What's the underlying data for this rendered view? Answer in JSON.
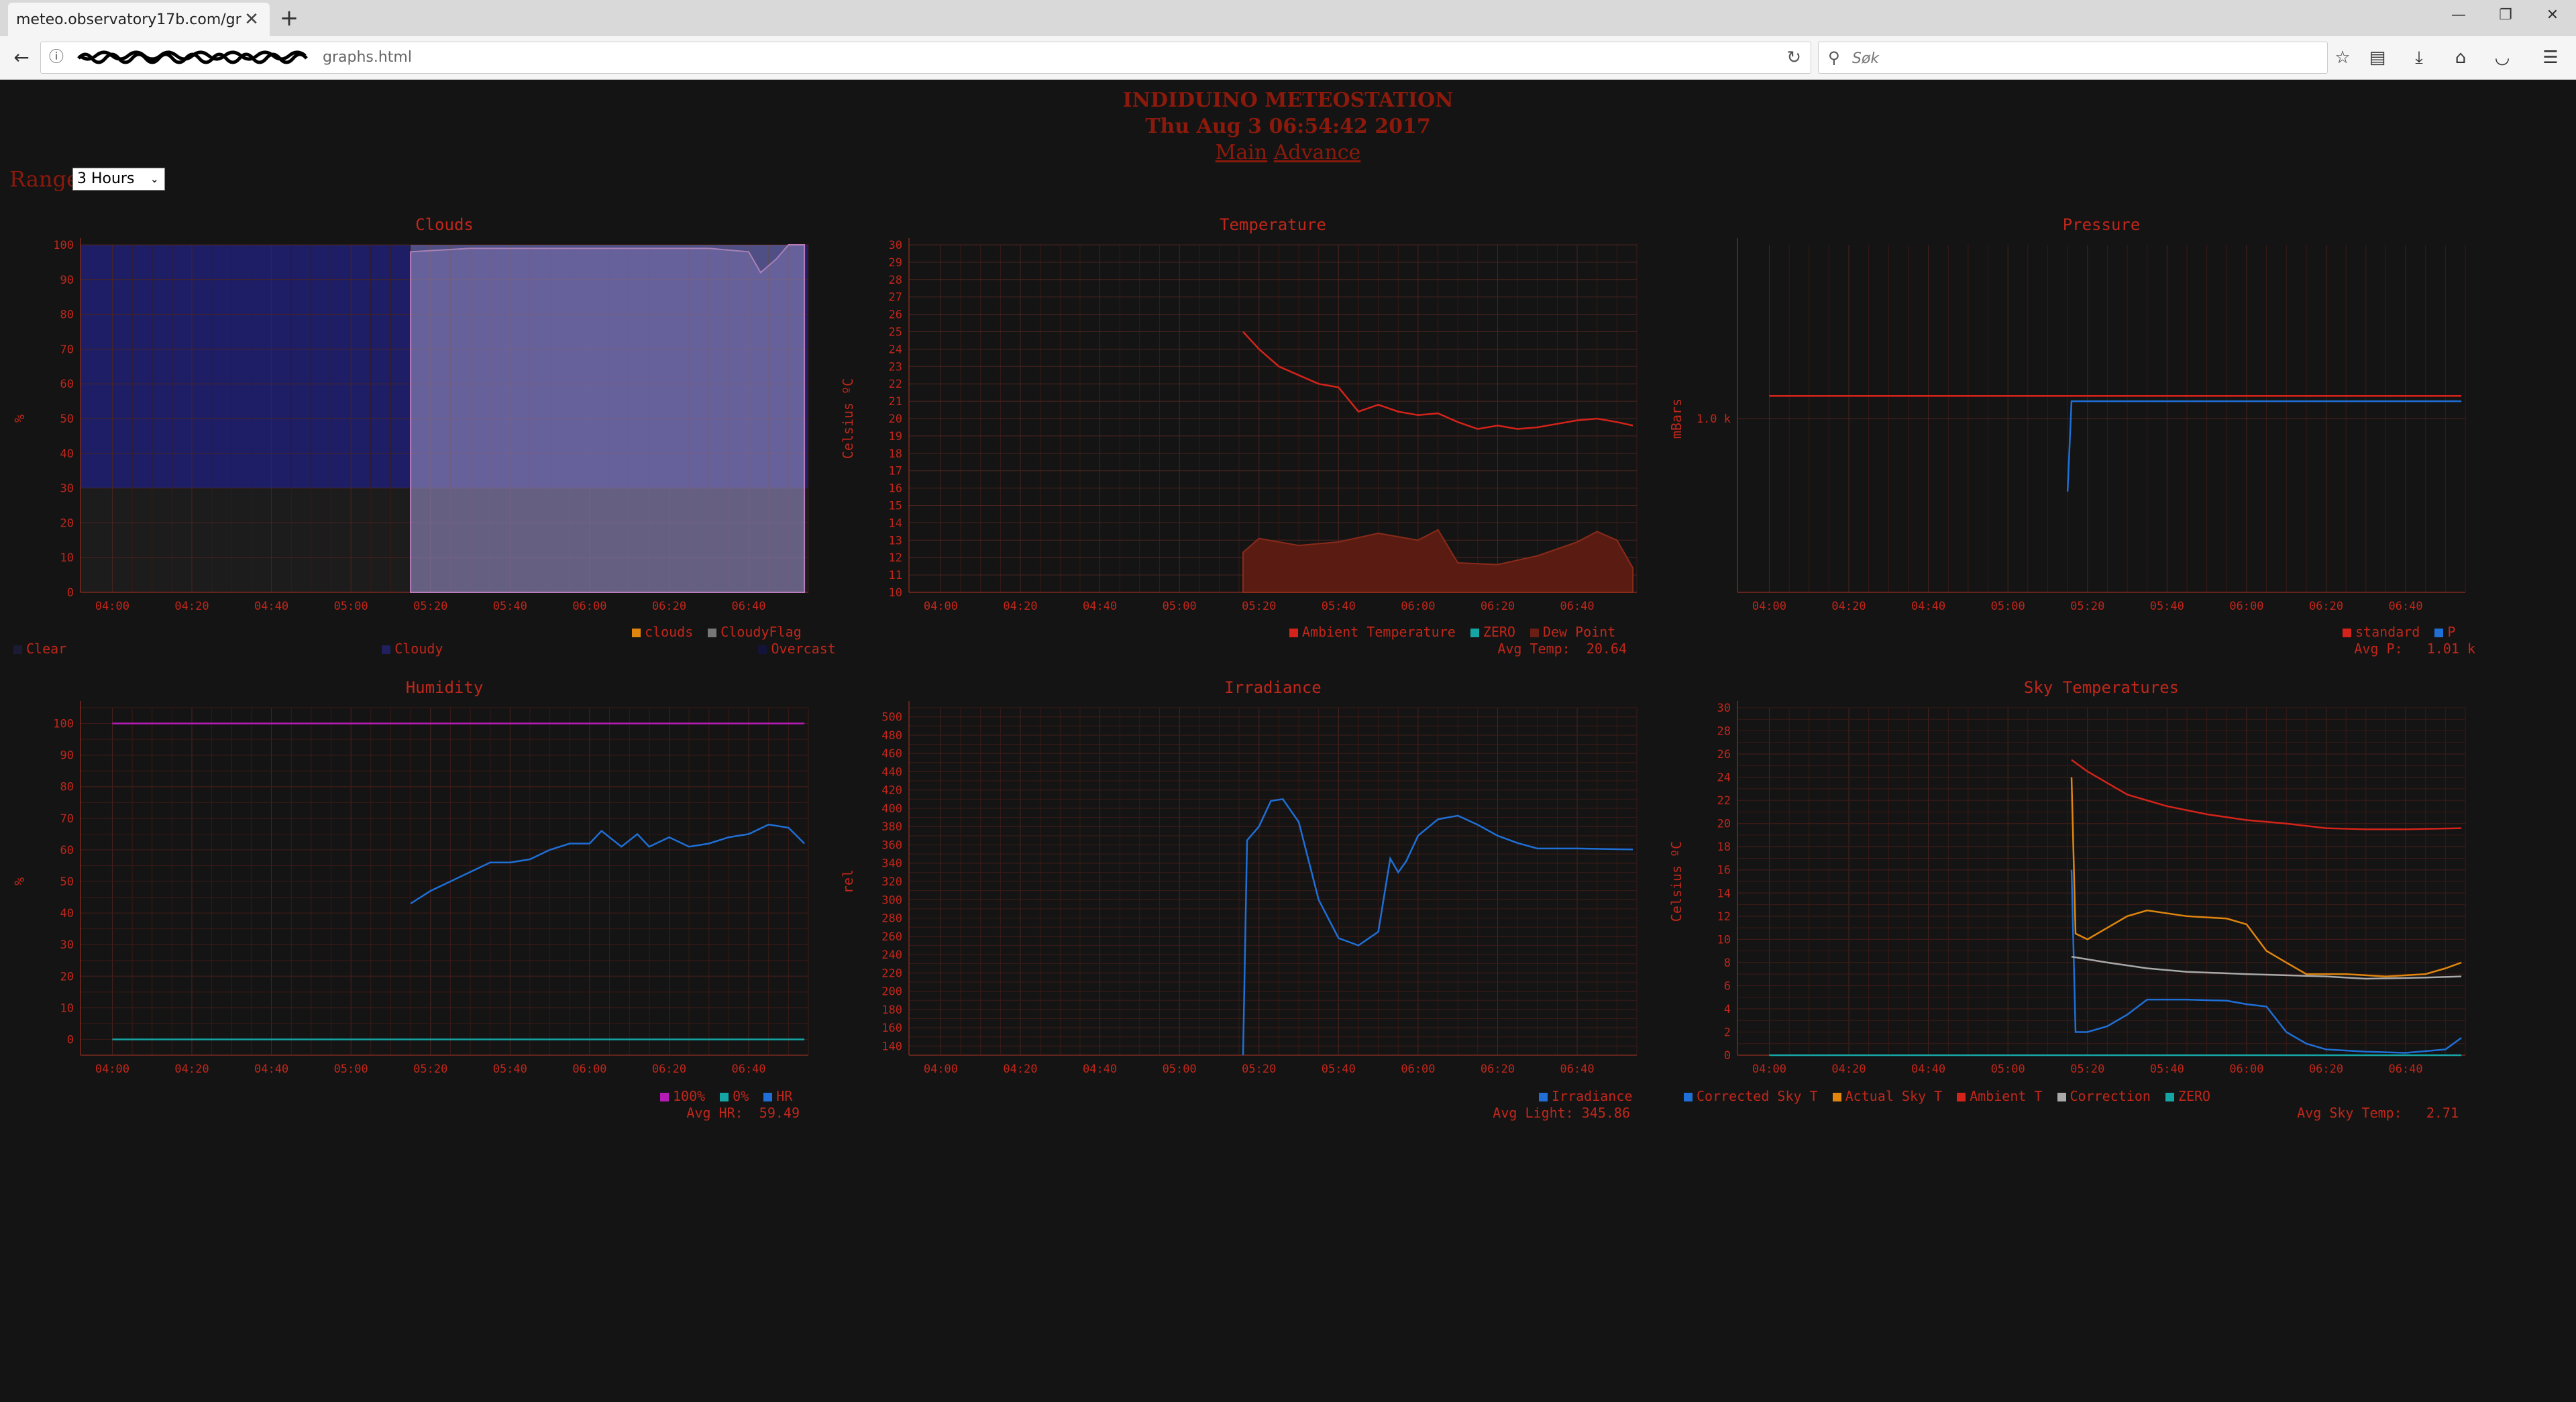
{
  "browser": {
    "tab_title": "meteo.observatory17b.com/grap",
    "url_suffix": "graphs.html",
    "search_placeholder": "Søk"
  },
  "page": {
    "title": "INDIDUINO METEOSTATION",
    "datetime": "Thu Aug 3 06:54:42 2017",
    "link_main": "Main",
    "link_advance": "Advance",
    "range_label": "Range",
    "range_value": "3 Hours"
  },
  "x_ticks": [
    "04:00",
    "04:20",
    "04:40",
    "05:00",
    "05:20",
    "05:40",
    "06:00",
    "06:20",
    "06:40"
  ],
  "charts": {
    "clouds": {
      "title": "Clouds",
      "ylabel": "%",
      "legend_row1": [
        {
          "label": "clouds",
          "color": "#e0860f"
        },
        {
          "label": "CloudyFlag",
          "color": "#777777"
        }
      ],
      "legend_row2": [
        {
          "label": "Clear",
          "color": "#1b1b36"
        },
        {
          "label": "Cloudy",
          "color": "#20205e"
        },
        {
          "label": "Overcast",
          "color": "#14143a"
        }
      ]
    },
    "temperature": {
      "title": "Temperature",
      "ylabel": "Celsius ºC",
      "legend": [
        {
          "label": "Ambient Temperature",
          "color": "#d4231a"
        },
        {
          "label": "ZERO",
          "color": "#16a5a5"
        },
        {
          "label": "Dew Point",
          "color": "#6b1e14"
        }
      ],
      "stat": "Avg Temp:  20.64"
    },
    "pressure": {
      "title": "Pressure",
      "ylabel": "mBars",
      "legend": [
        {
          "label": "standard",
          "color": "#d4231a"
        },
        {
          "label": "P",
          "color": "#1f6fd6"
        }
      ],
      "stat": "Avg P:   1.01 k"
    },
    "humidity": {
      "title": "Humidity",
      "ylabel": "%",
      "legend": [
        {
          "label": "100%",
          "color": "#b51bb5"
        },
        {
          "label": "0%",
          "color": "#16a5a5"
        },
        {
          "label": "HR",
          "color": "#1f6fd6"
        }
      ],
      "stat": "Avg HR:  59.49"
    },
    "irradiance": {
      "title": "Irradiance",
      "ylabel": "rel",
      "legend": [
        {
          "label": "Irradiance",
          "color": "#1f6fd6"
        }
      ],
      "stat": "Avg Light: 345.86"
    },
    "sky": {
      "title": "Sky Temperatures",
      "ylabel": "Celsius ºC",
      "legend": [
        {
          "label": "Corrected Sky T",
          "color": "#1f6fd6"
        },
        {
          "label": "Actual Sky T",
          "color": "#e0860f"
        },
        {
          "label": "Ambient T",
          "color": "#d4231a"
        },
        {
          "label": "Correction",
          "color": "#aaaaaa"
        },
        {
          "label": "ZERO",
          "color": "#16a5a5"
        }
      ],
      "stat": "Avg Sky Temp:   2.71"
    }
  },
  "chart_data": [
    {
      "type": "area",
      "title": "Clouds",
      "ylabel": "%",
      "x_ticks": [
        "04:00",
        "04:20",
        "04:40",
        "05:00",
        "05:20",
        "05:40",
        "06:00",
        "06:20",
        "06:40"
      ],
      "ylim": [
        0,
        100
      ],
      "ytick_values": [
        0,
        10,
        20,
        30,
        40,
        50,
        60,
        70,
        80,
        90,
        100
      ],
      "bands": [
        {
          "name": "Clear",
          "from": 0,
          "to": 30
        },
        {
          "name": "Overcast",
          "from": 30,
          "to": 100
        }
      ],
      "series": [
        {
          "name": "clouds",
          "points": [
            [
              "05:15",
              98
            ],
            [
              "05:30",
              99
            ],
            [
              "05:45",
              99
            ],
            [
              "06:00",
              99
            ],
            [
              "06:15",
              99
            ],
            [
              "06:30",
              99
            ],
            [
              "06:40",
              98
            ],
            [
              "06:43",
              92
            ],
            [
              "06:47",
              96
            ],
            [
              "06:50",
              100
            ],
            [
              "06:54",
              100
            ]
          ]
        },
        {
          "name": "CloudyFlag",
          "points": [
            [
              "05:15",
              100
            ],
            [
              "06:54",
              100
            ]
          ]
        }
      ]
    },
    {
      "type": "line",
      "title": "Temperature",
      "ylabel": "Celsius ºC",
      "x_ticks": [
        "04:00",
        "04:20",
        "04:40",
        "05:00",
        "05:20",
        "05:40",
        "06:00",
        "06:20",
        "06:40"
      ],
      "ylim": [
        10,
        30
      ],
      "ytick_values": [
        10,
        11,
        12,
        13,
        14,
        15,
        16,
        17,
        18,
        19,
        20,
        21,
        22,
        23,
        24,
        25,
        26,
        27,
        28,
        29,
        30
      ],
      "series": [
        {
          "name": "Ambient Temperature",
          "points": [
            [
              "05:16",
              25
            ],
            [
              "05:20",
              24
            ],
            [
              "05:25",
              23
            ],
            [
              "05:30",
              22.5
            ],
            [
              "05:35",
              22
            ],
            [
              "05:40",
              21.8
            ],
            [
              "05:45",
              20.4
            ],
            [
              "05:50",
              20.8
            ],
            [
              "05:55",
              20.4
            ],
            [
              "06:00",
              20.2
            ],
            [
              "06:05",
              20.3
            ],
            [
              "06:10",
              19.8
            ],
            [
              "06:15",
              19.4
            ],
            [
              "06:20",
              19.6
            ],
            [
              "06:25",
              19.4
            ],
            [
              "06:30",
              19.5
            ],
            [
              "06:35",
              19.7
            ],
            [
              "06:40",
              19.9
            ],
            [
              "06:45",
              20
            ],
            [
              "06:50",
              19.8
            ],
            [
              "06:54",
              19.6
            ]
          ]
        },
        {
          "name": "Dew Point",
          "points": [
            [
              "05:16",
              12.3
            ],
            [
              "05:20",
              13.1
            ],
            [
              "05:30",
              12.7
            ],
            [
              "05:40",
              12.9
            ],
            [
              "05:50",
              13.4
            ],
            [
              "06:00",
              13.0
            ],
            [
              "06:05",
              13.6
            ],
            [
              "06:10",
              11.7
            ],
            [
              "06:20",
              11.6
            ],
            [
              "06:30",
              12.1
            ],
            [
              "06:40",
              12.9
            ],
            [
              "06:45",
              13.5
            ],
            [
              "06:50",
              13.0
            ],
            [
              "06:54",
              11.4
            ]
          ]
        }
      ]
    },
    {
      "type": "line",
      "title": "Pressure",
      "ylabel": "mBars",
      "x_ticks": [
        "04:00",
        "04:20",
        "04:40",
        "05:00",
        "05:20",
        "05:40",
        "06:00",
        "06:20",
        "06:40"
      ],
      "yticks": [
        "1.0 k"
      ],
      "series": [
        {
          "name": "standard",
          "points": [
            [
              "04:00",
              1013
            ],
            [
              "06:54",
              1013
            ]
          ]
        },
        {
          "name": "P",
          "points": [
            [
              "05:15",
              958
            ],
            [
              "05:16",
              1010
            ],
            [
              "05:40",
              1010
            ],
            [
              "06:54",
              1010
            ]
          ]
        }
      ]
    },
    {
      "type": "line",
      "title": "Humidity",
      "ylabel": "%",
      "x_ticks": [
        "04:00",
        "04:20",
        "04:40",
        "05:00",
        "05:20",
        "05:40",
        "06:00",
        "06:20",
        "06:40"
      ],
      "ylim": [
        -5,
        105
      ],
      "ytick_values": [
        0,
        10,
        20,
        30,
        40,
        50,
        60,
        70,
        80,
        90,
        100
      ],
      "series": [
        {
          "name": "100%",
          "points": [
            [
              "04:00",
              100
            ],
            [
              "06:54",
              100
            ]
          ]
        },
        {
          "name": "0%",
          "points": [
            [
              "04:00",
              0
            ],
            [
              "06:54",
              0
            ]
          ]
        },
        {
          "name": "HR",
          "points": [
            [
              "05:15",
              43
            ],
            [
              "05:20",
              47
            ],
            [
              "05:25",
              50
            ],
            [
              "05:30",
              53
            ],
            [
              "05:35",
              56
            ],
            [
              "05:40",
              56
            ],
            [
              "05:45",
              57
            ],
            [
              "05:50",
              60
            ],
            [
              "05:55",
              62
            ],
            [
              "06:00",
              62
            ],
            [
              "06:03",
              66
            ],
            [
              "06:08",
              61
            ],
            [
              "06:12",
              65
            ],
            [
              "06:15",
              61
            ],
            [
              "06:20",
              64
            ],
            [
              "06:25",
              61
            ],
            [
              "06:30",
              62
            ],
            [
              "06:35",
              64
            ],
            [
              "06:40",
              65
            ],
            [
              "06:45",
              68
            ],
            [
              "06:50",
              67
            ],
            [
              "06:54",
              62
            ]
          ]
        }
      ]
    },
    {
      "type": "line",
      "title": "Irradiance",
      "ylabel": "rel",
      "x_ticks": [
        "04:00",
        "04:20",
        "04:40",
        "05:00",
        "05:20",
        "05:40",
        "06:00",
        "06:20",
        "06:40"
      ],
      "ylim": [
        130,
        510
      ],
      "ytick_values": [
        140,
        160,
        180,
        200,
        220,
        240,
        260,
        280,
        300,
        320,
        340,
        360,
        380,
        400,
        420,
        440,
        460,
        480,
        500
      ],
      "series": [
        {
          "name": "Irradiance",
          "points": [
            [
              "05:16",
              130
            ],
            [
              "05:17",
              365
            ],
            [
              "05:20",
              380
            ],
            [
              "05:23",
              408
            ],
            [
              "05:26",
              410
            ],
            [
              "05:30",
              385
            ],
            [
              "05:35",
              300
            ],
            [
              "05:40",
              258
            ],
            [
              "05:45",
              250
            ],
            [
              "05:50",
              265
            ],
            [
              "05:53",
              345
            ],
            [
              "05:55",
              330
            ],
            [
              "05:57",
              342
            ],
            [
              "06:00",
              370
            ],
            [
              "06:05",
              388
            ],
            [
              "06:10",
              392
            ],
            [
              "06:15",
              382
            ],
            [
              "06:20",
              370
            ],
            [
              "06:25",
              362
            ],
            [
              "06:30",
              356
            ],
            [
              "06:40",
              356
            ],
            [
              "06:54",
              355
            ]
          ]
        }
      ]
    },
    {
      "type": "line",
      "title": "Sky Temperatures",
      "ylabel": "Celsius ºC",
      "x_ticks": [
        "04:00",
        "04:20",
        "04:40",
        "05:00",
        "05:20",
        "05:40",
        "06:00",
        "06:20",
        "06:40"
      ],
      "ylim": [
        0,
        30
      ],
      "ytick_values": [
        0,
        2,
        4,
        6,
        8,
        10,
        12,
        14,
        16,
        18,
        20,
        22,
        24,
        26,
        28,
        30
      ],
      "series": [
        {
          "name": "Corrected Sky T",
          "points": [
            [
              "05:16",
              16
            ],
            [
              "05:17",
              2
            ],
            [
              "05:20",
              2
            ],
            [
              "05:25",
              2.5
            ],
            [
              "05:30",
              3.5
            ],
            [
              "05:35",
              4.8
            ],
            [
              "05:45",
              4.8
            ],
            [
              "05:55",
              4.7
            ],
            [
              "06:00",
              4.4
            ],
            [
              "06:05",
              4.2
            ],
            [
              "06:10",
              2
            ],
            [
              "06:15",
              1
            ],
            [
              "06:20",
              0.5
            ],
            [
              "06:30",
              0.3
            ],
            [
              "06:40",
              0.2
            ],
            [
              "06:50",
              0.5
            ],
            [
              "06:54",
              1.5
            ]
          ]
        },
        {
          "name": "Actual Sky T",
          "points": [
            [
              "05:16",
              24
            ],
            [
              "05:17",
              10.5
            ],
            [
              "05:20",
              10
            ],
            [
              "05:25",
              11
            ],
            [
              "05:30",
              12
            ],
            [
              "05:35",
              12.5
            ],
            [
              "05:45",
              12
            ],
            [
              "05:55",
              11.8
            ],
            [
              "06:00",
              11.3
            ],
            [
              "06:05",
              9
            ],
            [
              "06:10",
              8
            ],
            [
              "06:15",
              7
            ],
            [
              "06:25",
              7
            ],
            [
              "06:35",
              6.8
            ],
            [
              "06:45",
              7
            ],
            [
              "06:50",
              7.5
            ],
            [
              "06:54",
              8
            ]
          ]
        },
        {
          "name": "Ambient T",
          "points": [
            [
              "05:16",
              25.5
            ],
            [
              "05:20",
              24.5
            ],
            [
              "05:30",
              22.5
            ],
            [
              "05:40",
              21.5
            ],
            [
              "05:50",
              20.8
            ],
            [
              "06:00",
              20.3
            ],
            [
              "06:10",
              20
            ],
            [
              "06:20",
              19.6
            ],
            [
              "06:30",
              19.5
            ],
            [
              "06:40",
              19.5
            ],
            [
              "06:54",
              19.6
            ]
          ]
        },
        {
          "name": "Correction",
          "points": [
            [
              "05:16",
              8.5
            ],
            [
              "05:25",
              8
            ],
            [
              "05:35",
              7.5
            ],
            [
              "05:45",
              7.2
            ],
            [
              "06:00",
              7
            ],
            [
              "06:10",
              6.9
            ],
            [
              "06:20",
              6.8
            ],
            [
              "06:30",
              6.6
            ],
            [
              "06:45",
              6.7
            ],
            [
              "06:54",
              6.8
            ]
          ]
        },
        {
          "name": "ZERO",
          "points": [
            [
              "04:00",
              0
            ],
            [
              "06:54",
              0
            ]
          ]
        }
      ]
    }
  ]
}
